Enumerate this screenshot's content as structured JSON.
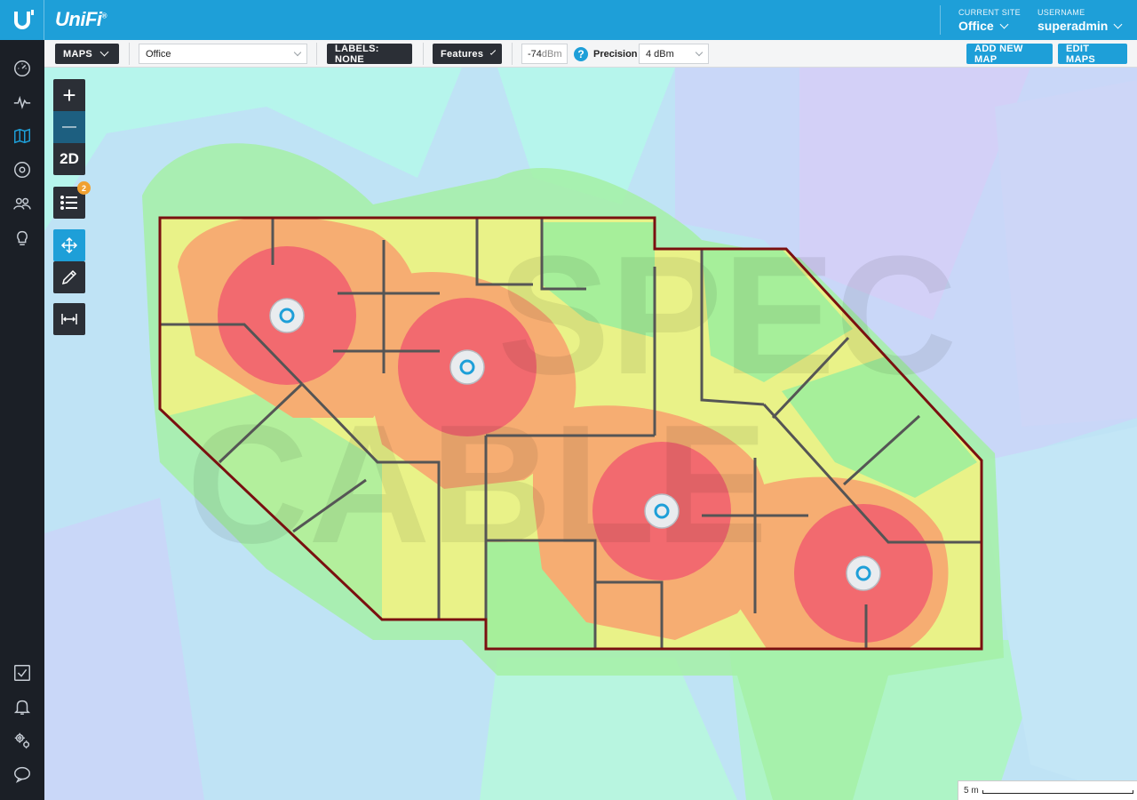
{
  "header": {
    "brand": "UniFi",
    "brand_mark": "®",
    "current_site_label": "CURRENT SITE",
    "current_site_value": "Office",
    "username_label": "USERNAME",
    "username_value": "superadmin"
  },
  "sidebar": {
    "top_items": [
      {
        "name": "dashboard-icon"
      },
      {
        "name": "statistics-icon"
      },
      {
        "name": "map-icon",
        "active": true
      },
      {
        "name": "devices-icon"
      },
      {
        "name": "clients-icon"
      },
      {
        "name": "insights-icon"
      }
    ],
    "bottom_items": [
      {
        "name": "events-icon"
      },
      {
        "name": "alerts-icon"
      },
      {
        "name": "settings-icon"
      },
      {
        "name": "chat-icon"
      }
    ]
  },
  "toolbar": {
    "maps_label": "MAPS",
    "map_select_value": "Office",
    "labels_label": "LABELS: NONE",
    "features_label": "Features",
    "dbm_value": "-74",
    "dbm_unit": "dBm",
    "help_glyph": "?",
    "precision_label": "Precision",
    "precision_value": "4 dBm",
    "add_map_label": "ADD NEW MAP",
    "edit_maps_label": "EDIT MAPS"
  },
  "map_controls": {
    "zoom_in_glyph": "+",
    "zoom_out_glyph": "—",
    "view_mode": "2D",
    "list_badge_count": "2"
  },
  "map": {
    "watermark_top": "SPEC",
    "watermark_bottom": "CABLE",
    "access_points": 4
  },
  "scale": {
    "label": "5 m"
  },
  "colors": {
    "accent": "#1e9fd8",
    "sidebar": "#1b1f26",
    "heat_strong": "#f26a6f",
    "heat_good": "#f5a56a",
    "heat_fair": "#e9f28a",
    "heat_weak": "#9cef9a",
    "heat_poor": "#b8f5ea",
    "wall": "#7a1010"
  }
}
